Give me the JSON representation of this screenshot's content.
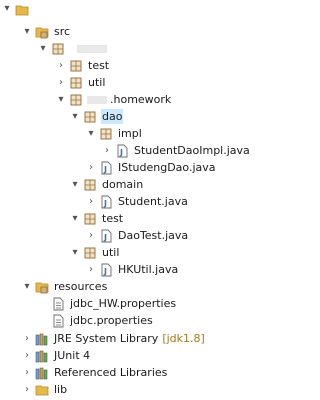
{
  "tree": {
    "top": {
      "label": ""
    },
    "src": {
      "label": "src"
    },
    "pkg_root": {
      "label": ""
    },
    "test_pkg": {
      "label": "test"
    },
    "util_pkg": {
      "label": "util"
    },
    "homework_pkg": {
      "label": ".homework"
    },
    "dao": {
      "label": "dao"
    },
    "impl": {
      "label": "impl"
    },
    "studentdaoimpl": {
      "label": "StudentDaoImpl.java"
    },
    "istudengdao": {
      "label": "IStudengDao.java"
    },
    "domain": {
      "label": "domain"
    },
    "student": {
      "label": "Student.java"
    },
    "test_sub": {
      "label": "test"
    },
    "daotest": {
      "label": "DaoTest.java"
    },
    "util_sub": {
      "label": "util"
    },
    "hkutil": {
      "label": "HKUtil.java"
    },
    "resources": {
      "label": "resources"
    },
    "jdbc_hw": {
      "label": "jdbc_HW.properties"
    },
    "jdbc": {
      "label": "jdbc.properties"
    },
    "jre": {
      "label": "JRE System Library",
      "suffix": "[jdk1.8]"
    },
    "junit": {
      "label": "JUnit 4"
    },
    "referenced": {
      "label": "Referenced Libraries"
    },
    "lib": {
      "label": "lib"
    }
  },
  "icons": {
    "expanded": "chevron-down-icon",
    "collapsed": "chevron-right-icon",
    "folder": "source-folder-icon",
    "package": "package-icon",
    "java": "java-file-icon",
    "properties": "properties-file-icon",
    "library": "library-icon"
  },
  "colors": {
    "selection": "#cce8ff",
    "package": "#8a6a3a",
    "java": "#3d6fb4",
    "folder": "#e6b84a",
    "library_suffix": "#a07a1a"
  }
}
